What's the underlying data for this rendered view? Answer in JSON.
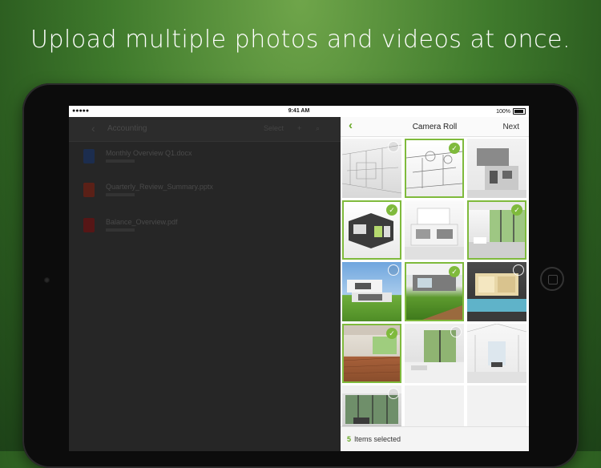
{
  "headline": "Upload multiple photos and videos at once.",
  "status_bar": {
    "left": "●●●●● ",
    "time": "9:41 AM",
    "battery": "100%"
  },
  "background_app": {
    "title": "Accounting",
    "actions": [
      "Select",
      "+",
      "⌕"
    ],
    "files": [
      {
        "name": "Monthly Overview Q1.docx",
        "color": "#1c3f7a"
      },
      {
        "name": "Quarterly_Review_Summary.pptx",
        "color": "#8e2a1c"
      },
      {
        "name": "Balance_Overview.pdf",
        "color": "#8a1b1b"
      }
    ]
  },
  "picker": {
    "back_label": "‹",
    "title": "Camera Roll",
    "next_label": "Next",
    "selected_count": "5",
    "selected_label": "Items selected",
    "accent": "#7fba3c",
    "thumbnails": [
      {
        "kind": "sketch-interior",
        "selected": false
      },
      {
        "kind": "sketch-fan-room",
        "selected": true
      },
      {
        "kind": "grey-house",
        "selected": false
      },
      {
        "kind": "modern-cube-house",
        "selected": true
      },
      {
        "kind": "white-villa",
        "selected": false
      },
      {
        "kind": "glass-living-room",
        "selected": true
      },
      {
        "kind": "lawn-house",
        "selected": false
      },
      {
        "kind": "garden-terrace",
        "selected": true
      },
      {
        "kind": "pool-house-night",
        "selected": false
      },
      {
        "kind": "wood-floor-room",
        "selected": true
      },
      {
        "kind": "white-interior-window",
        "selected": false
      },
      {
        "kind": "atrium-interior",
        "selected": false
      },
      {
        "kind": "glass-pavilion",
        "selected": false
      }
    ]
  }
}
